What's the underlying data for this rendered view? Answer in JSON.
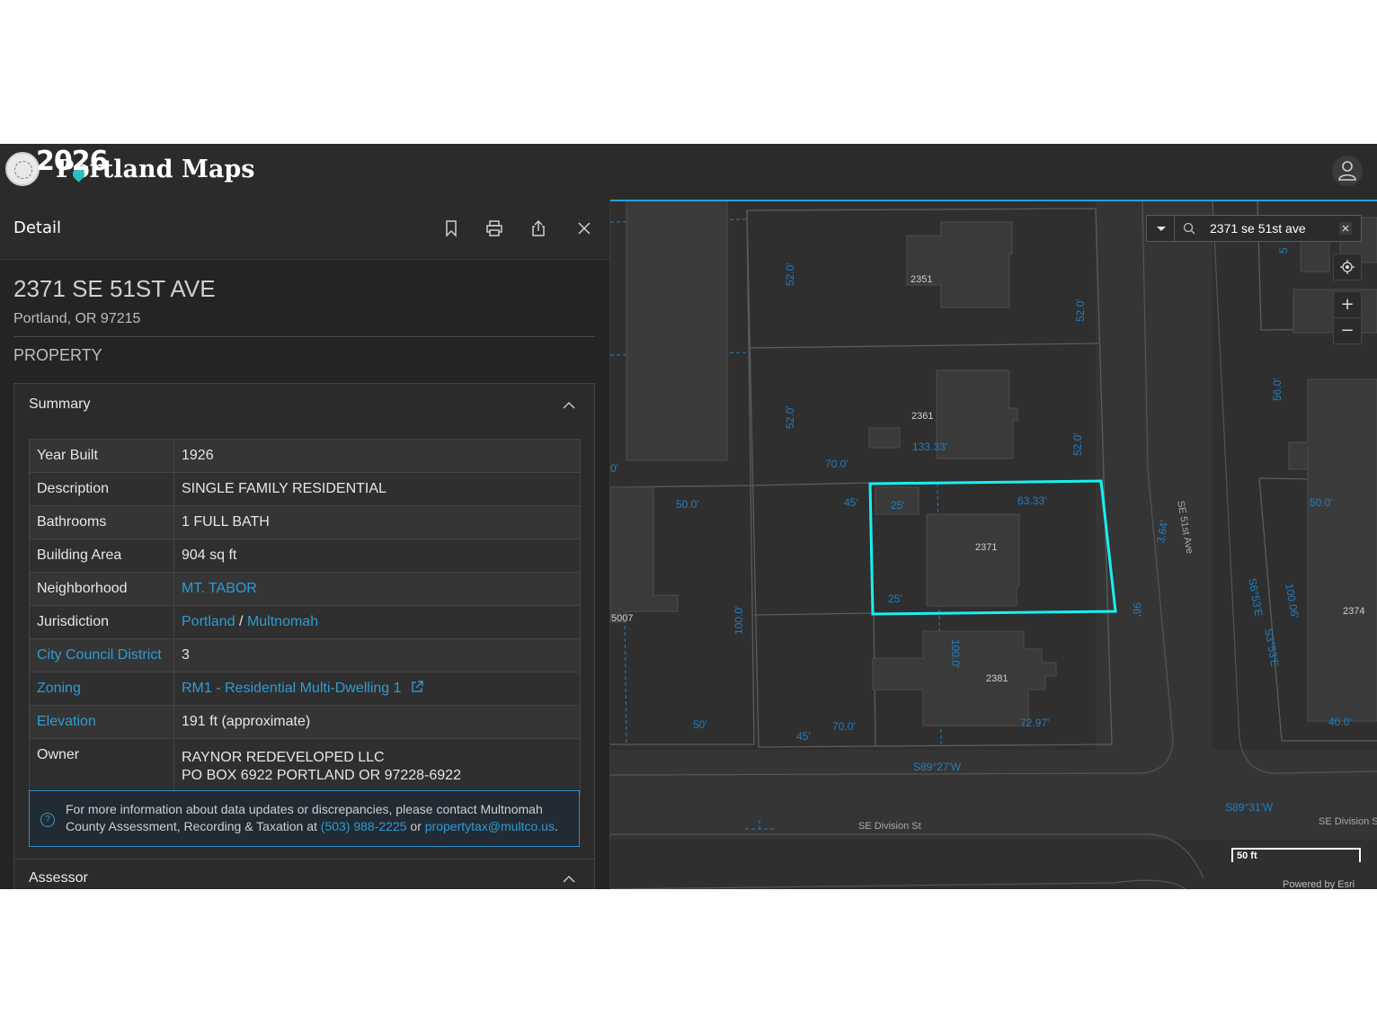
{
  "header": {
    "logo_watermark": "2026",
    "logo_text": "Portland Maps"
  },
  "panel": {
    "title": "Detail",
    "address": "2371 SE 51ST AVE",
    "city_state": "Portland, OR 97215",
    "section": "PROPERTY",
    "summary": {
      "title": "Summary",
      "rows": {
        "year_built": {
          "label": "Year Built",
          "value": "1926"
        },
        "description": {
          "label": "Description",
          "value": "SINGLE FAMILY RESIDENTIAL"
        },
        "bathrooms": {
          "label": "Bathrooms",
          "value": "1 FULL BATH"
        },
        "building_area": {
          "label": "Building Area",
          "value": "904 sq ft"
        },
        "neighborhood": {
          "label": "Neighborhood",
          "value": "MT. TABOR"
        },
        "jurisdiction": {
          "label": "Jurisdiction",
          "value_1": "Portland",
          "sep": "/",
          "value_2": "Multnomah"
        },
        "council": {
          "label": "City Council District",
          "value": "3"
        },
        "zoning": {
          "label": "Zoning",
          "value": "RM1 - Residential Multi-Dwelling 1"
        },
        "elevation": {
          "label": "Elevation",
          "value": "191 ft (approximate)"
        },
        "owner": {
          "label": "Owner",
          "line1": "RAYNOR REDEVELOPED LLC",
          "line2": "PO BOX 6922 PORTLAND OR 97228-6922"
        }
      },
      "info": {
        "text_1": "For more information about data updates or discrepancies, please contact Multnomah County Assessment, Recording & Taxation at",
        "phone": "(503) 988-2225",
        "or": "or",
        "email": "propertytax@multco.us",
        "period": "."
      }
    },
    "assessor_title": "Assessor"
  },
  "map": {
    "search_value": "2371 se 51st ave",
    "zoom_in": "+",
    "zoom_out": "−",
    "scale_label": "50 ft",
    "attribution": "Powered by Esri",
    "lot_numbers": [
      "2351",
      "2361",
      "2371",
      "2381",
      "5007",
      "2374"
    ],
    "streets": [
      "SE 51st Ave",
      "SE Division St",
      "SE Division S"
    ],
    "dims": [
      "52.0'",
      "52.0'",
      "52.0'",
      "52.0'",
      "133.33'",
      "70.0'",
      "50.0'",
      "45'",
      "25'",
      "63.33'",
      "25'",
      "100.0'",
      "100.0'",
      "50'",
      "45'",
      "70.0'",
      "72.97'",
      "3.64'",
      "96'",
      "56.0'",
      "50.0'",
      "100.06'",
      "S6°53'E",
      "S3°53'E",
      "40.0'",
      "S89°27'W",
      "S89°31'W",
      "0'",
      "5"
    ]
  },
  "colors": {
    "accent_link": "#2f9bd6",
    "selected_parcel": "#19f0f0",
    "map_dim": "#1f7fc4",
    "panel_bg": "#242424"
  }
}
